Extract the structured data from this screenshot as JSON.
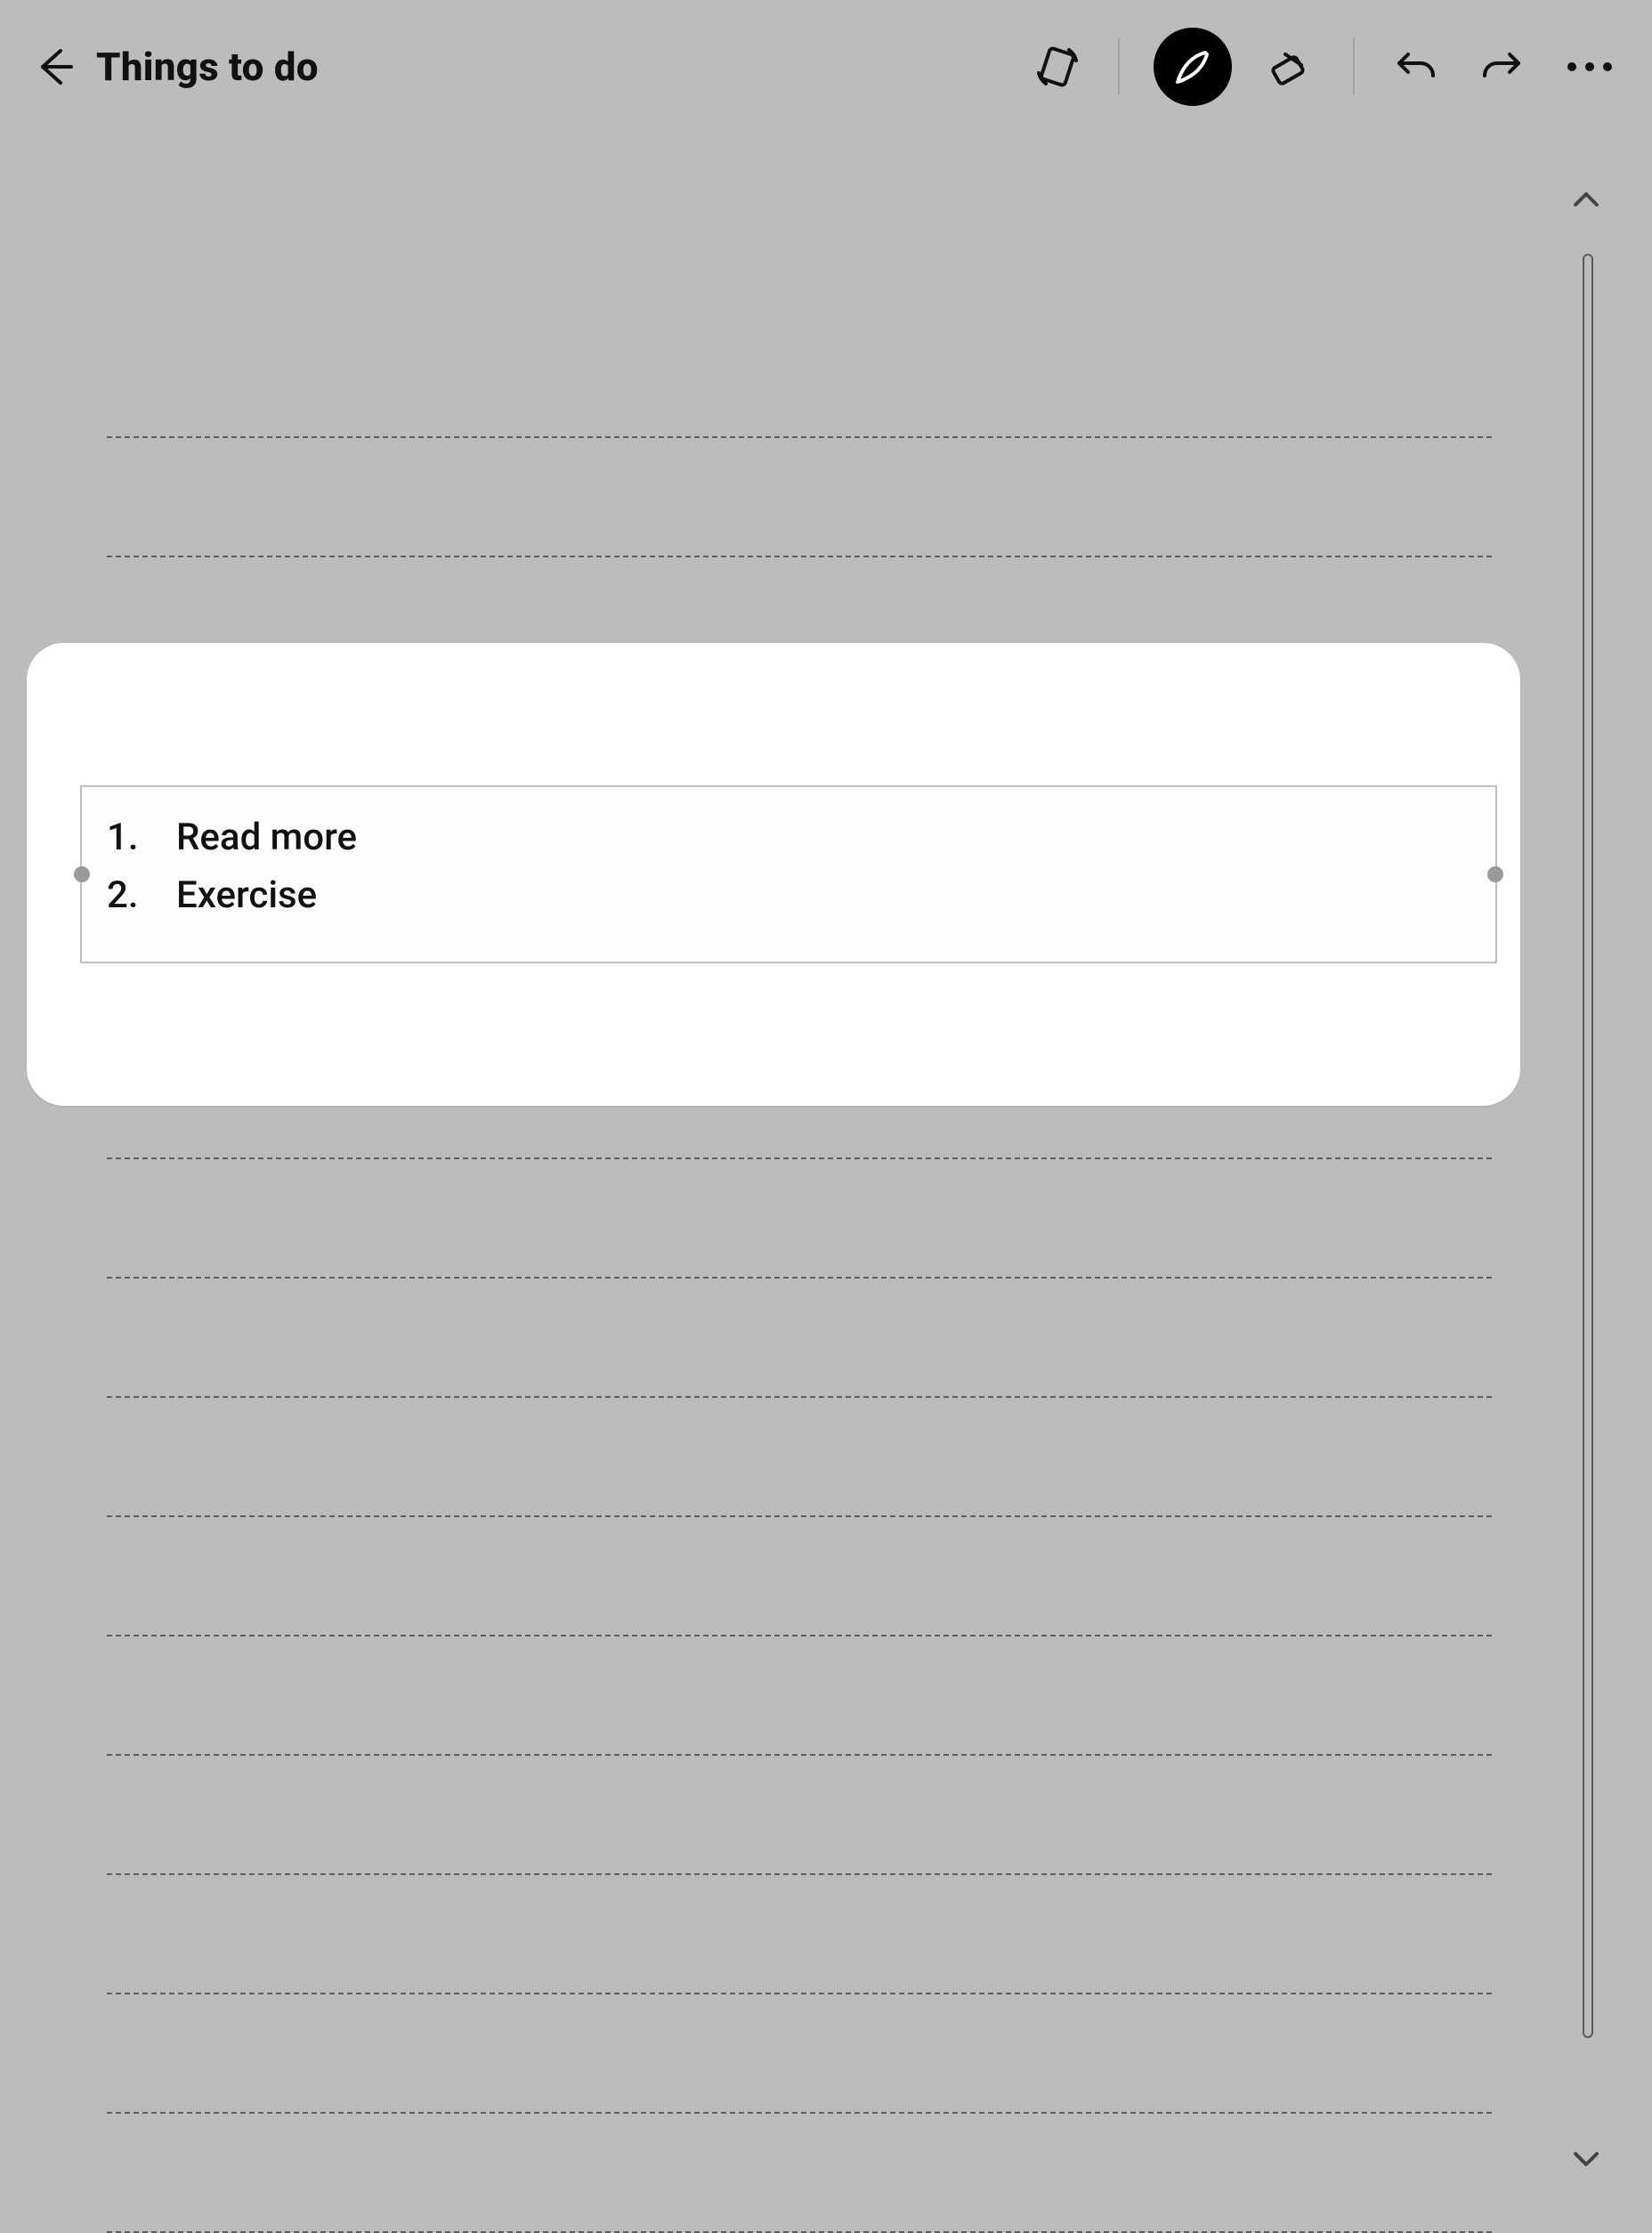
{
  "header": {
    "title": "Things to do"
  },
  "toolbar": {
    "back_icon": "arrow-left",
    "rotate_icon": "rotate-device",
    "pen_icon": "pen",
    "eraser_icon": "eraser",
    "undo_icon": "undo",
    "redo_icon": "redo",
    "more_icon": "more-horizontal",
    "active_tool": "pen"
  },
  "text_box": {
    "items": [
      {
        "index": "1.",
        "text": "Read more"
      },
      {
        "index": "2.",
        "text": "Exercise"
      }
    ]
  },
  "scroll": {
    "up_icon": "chevron-up",
    "down_icon": "chevron-down"
  }
}
